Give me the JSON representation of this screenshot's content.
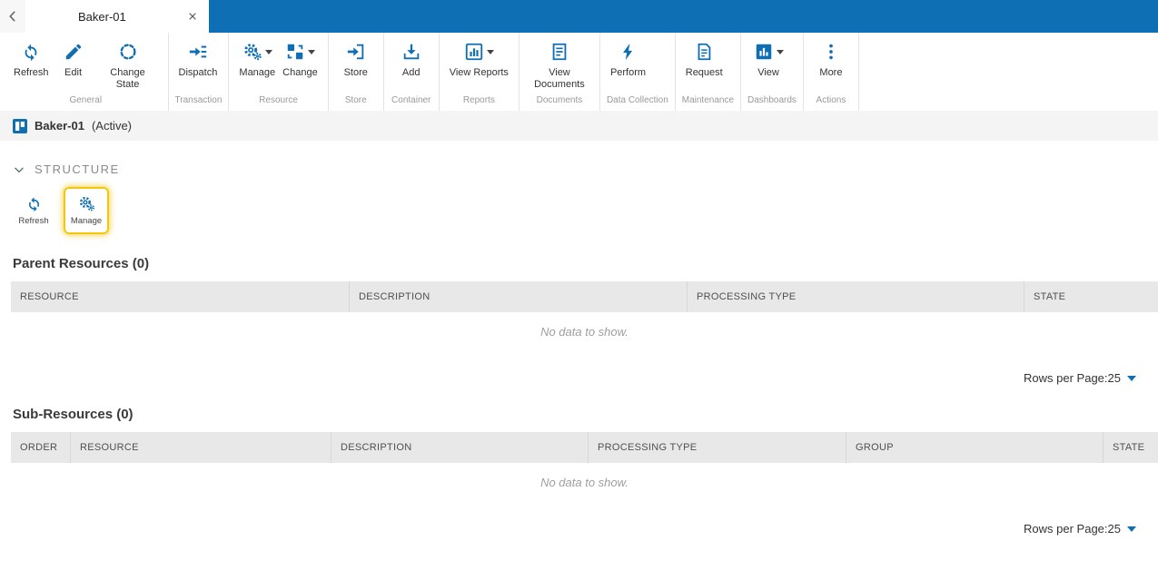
{
  "colors": {
    "accent_blue": "#0f6fb4",
    "highlight_yellow": "#f3c60f",
    "table_header_bg": "#e8e8e8"
  },
  "topbar": {
    "back_icon": "chevron-left-icon",
    "tab_title": "Baker-01",
    "close_icon": "close-icon"
  },
  "toolbar": {
    "groups": [
      {
        "label": "General",
        "buttons": [
          {
            "label": "Refresh",
            "icon": "refresh-icon"
          },
          {
            "label": "Edit",
            "icon": "edit-icon"
          },
          {
            "label": "Change State",
            "icon": "change-state-icon"
          }
        ]
      },
      {
        "label": "Transaction",
        "buttons": [
          {
            "label": "Dispatch",
            "icon": "dispatch-icon"
          }
        ]
      },
      {
        "label": "Resource",
        "buttons": [
          {
            "label": "Manage",
            "icon": "manage-icon",
            "has_dropdown": true
          },
          {
            "label": "Change",
            "icon": "change-icon",
            "has_dropdown": true
          }
        ]
      },
      {
        "label": "Store",
        "buttons": [
          {
            "label": "Store",
            "icon": "store-icon"
          }
        ]
      },
      {
        "label": "Container",
        "buttons": [
          {
            "label": "Add",
            "icon": "add-icon"
          }
        ]
      },
      {
        "label": "Reports",
        "buttons": [
          {
            "label": "View Reports",
            "icon": "view-reports-icon",
            "has_dropdown": true
          }
        ]
      },
      {
        "label": "Documents",
        "buttons": [
          {
            "label": "View Documents",
            "icon": "view-documents-icon"
          }
        ]
      },
      {
        "label": "Data Collection",
        "buttons": [
          {
            "label": "Perform",
            "icon": "perform-icon"
          }
        ]
      },
      {
        "label": "Maintenance",
        "buttons": [
          {
            "label": "Request",
            "icon": "request-icon"
          }
        ]
      },
      {
        "label": "Dashboards",
        "buttons": [
          {
            "label": "View",
            "icon": "view-icon",
            "has_dropdown": true
          }
        ]
      },
      {
        "label": "Actions",
        "buttons": [
          {
            "label": "More",
            "icon": "more-icon"
          }
        ]
      }
    ]
  },
  "titlebar": {
    "icon": "resource-icon",
    "title": "Baker-01",
    "status": "(Active)"
  },
  "structure": {
    "label": "STRUCTURE",
    "collapse_icon": "chevron-down-icon",
    "actions": [
      {
        "label": "Refresh",
        "icon": "refresh-icon",
        "highlighted": false
      },
      {
        "label": "Manage",
        "icon": "manage-icon",
        "highlighted": true
      }
    ]
  },
  "parent_resources": {
    "title": "Parent Resources (0)",
    "columns": [
      "RESOURCE",
      "DESCRIPTION",
      "PROCESSING TYPE",
      "STATE"
    ],
    "empty_text": "No data to show.",
    "rows_per_page_label": "Rows per Page:",
    "rows_per_page_value": "25"
  },
  "sub_resources": {
    "title": "Sub-Resources (0)",
    "columns": [
      "ORDER",
      "RESOURCE",
      "DESCRIPTION",
      "PROCESSING TYPE",
      "GROUP",
      "STATE"
    ],
    "empty_text": "No data to show.",
    "rows_per_page_label": "Rows per Page:",
    "rows_per_page_value": "25"
  }
}
